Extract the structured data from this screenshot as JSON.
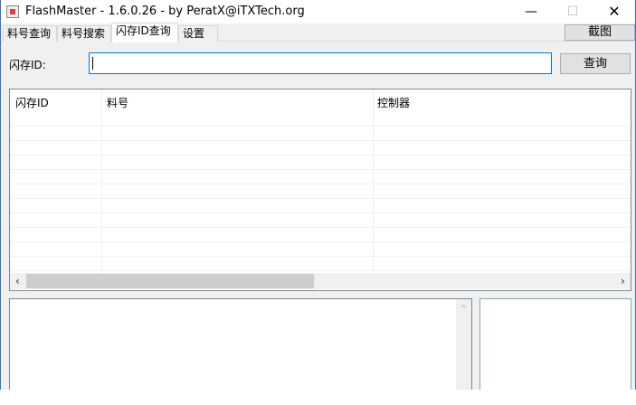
{
  "window": {
    "title": "FlashMaster - 1.6.0.26 - by PeratX@iTXTech.org"
  },
  "tabs": [
    {
      "label": "料号查询"
    },
    {
      "label": "料号搜索"
    },
    {
      "label": "闪存ID查询",
      "selected": true
    },
    {
      "label": "设置"
    }
  ],
  "screenshot_label": "截图",
  "query": {
    "label": "闪存ID:",
    "value": "",
    "button": "查询"
  },
  "table": {
    "columns": [
      "闪存ID",
      "料号",
      "控制器"
    ],
    "rows": []
  },
  "colors": {
    "accent": "#0078d7",
    "button_bg": "#e1e1e1"
  }
}
